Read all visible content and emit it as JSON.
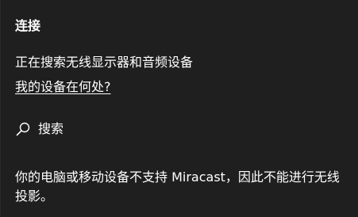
{
  "panel": {
    "title": "连接",
    "status": "正在搜索无线显示器和音频设备",
    "help_link": "我的设备在何处?",
    "search_label": "搜索",
    "search_icon": "search-icon",
    "message": "你的电脑或移动设备不支持 Miracast，因此不能进行无线投影。"
  },
  "colors": {
    "background": "#1f1f1f",
    "text": "#ffffff"
  }
}
